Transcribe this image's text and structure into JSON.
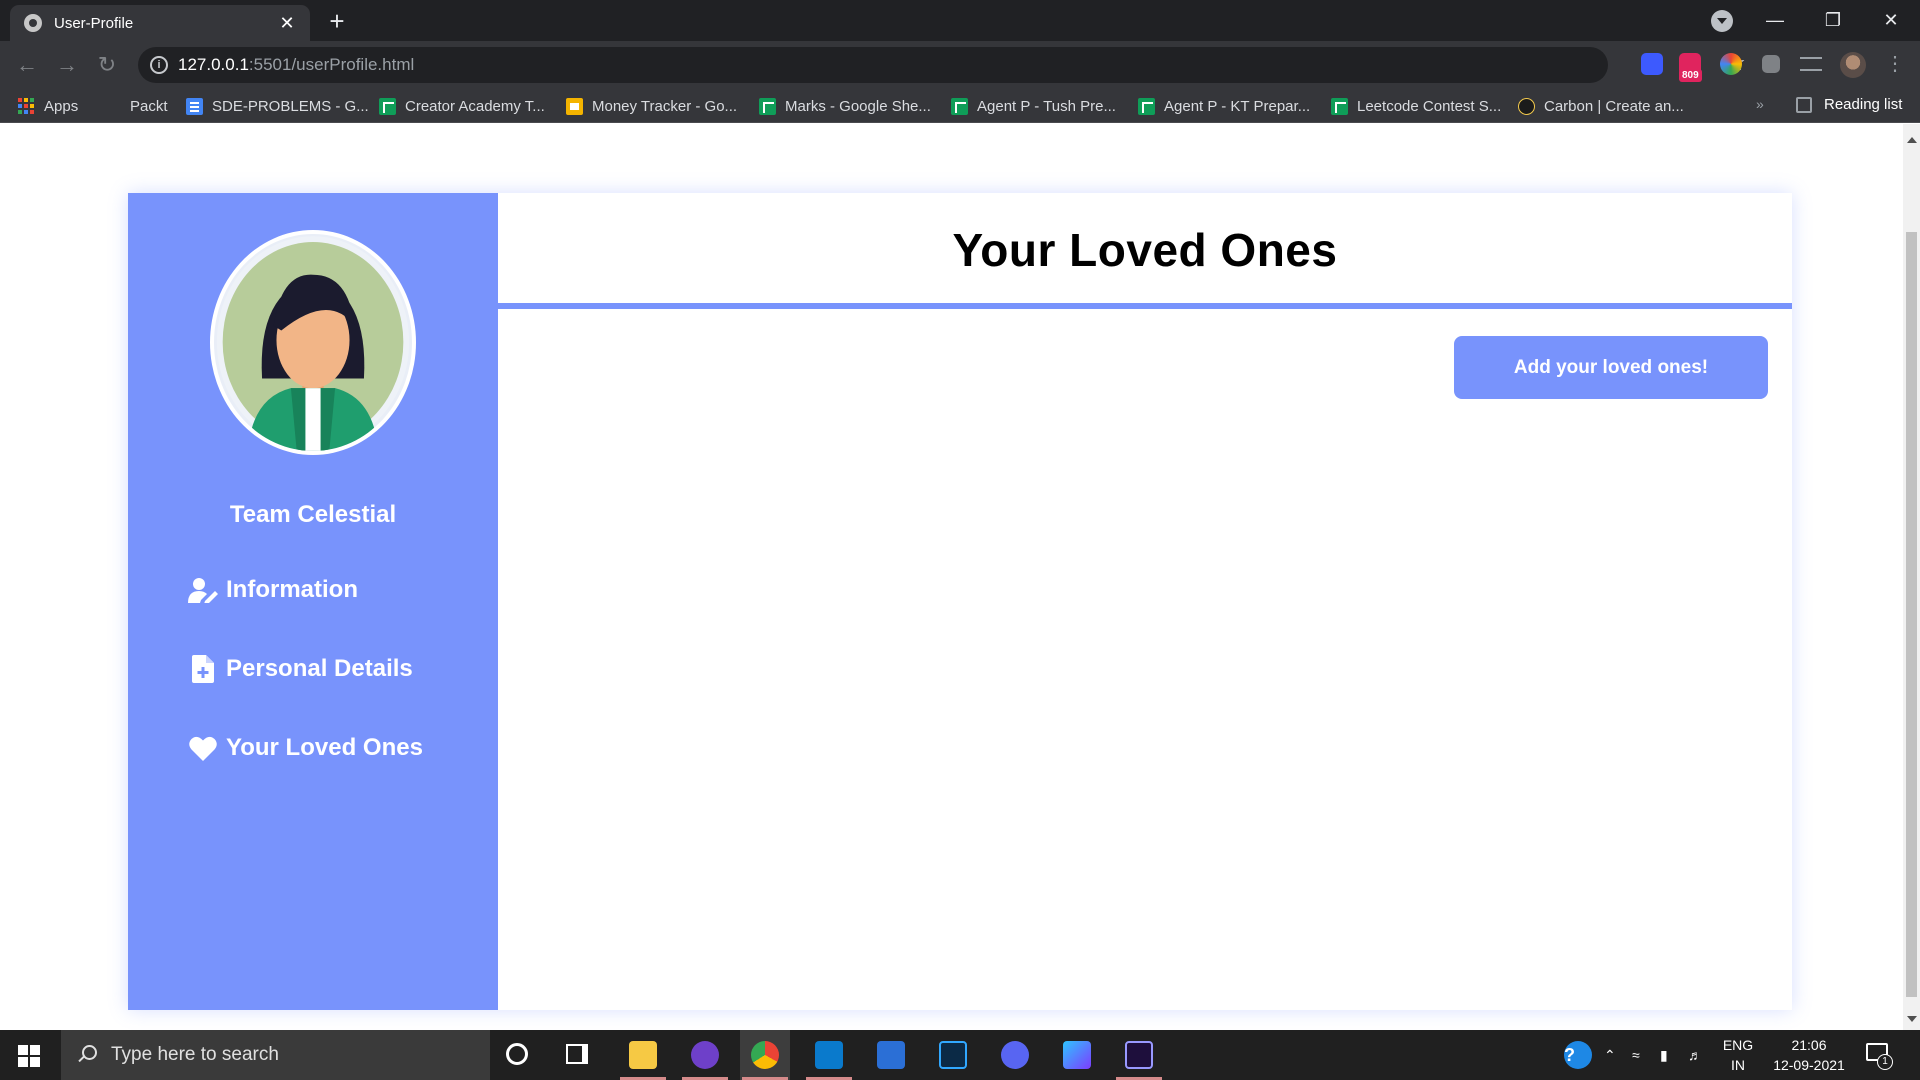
{
  "browser": {
    "tab_title": "User-Profile",
    "tab_close": "✕",
    "new_tab": "+",
    "url_host": "127.0.0.1",
    "url_rest": ":5501/userProfile.html",
    "extension_badge": "809",
    "bookmarks": [
      {
        "label": "Apps",
        "icon": "apps-icon"
      },
      {
        "label": "Packt",
        "icon": "none"
      },
      {
        "label": "SDE-PROBLEMS - G...",
        "icon": "docs-icon"
      },
      {
        "label": "Creator Academy T...",
        "icon": "sheets-icon"
      },
      {
        "label": "Money Tracker - Go...",
        "icon": "slides-icon"
      },
      {
        "label": "Marks - Google She...",
        "icon": "sheets-icon"
      },
      {
        "label": "Agent P - Tush Pre...",
        "icon": "sheets-icon"
      },
      {
        "label": "Agent P - KT Prepar...",
        "icon": "sheets-icon"
      },
      {
        "label": "Leetcode Contest S...",
        "icon": "sheets-icon"
      },
      {
        "label": "Carbon | Create an...",
        "icon": "carbon-icon"
      }
    ],
    "bookmarks_overflow": "»",
    "reading_list": "Reading list"
  },
  "sidebar": {
    "team_name": "Team Celestial",
    "items": [
      {
        "label": "Information",
        "icon": "user-edit-icon"
      },
      {
        "label": "Personal Details",
        "icon": "file-plus-icon"
      },
      {
        "label": "Your Loved Ones",
        "icon": "heart-icon"
      }
    ]
  },
  "main": {
    "title": "Your Loved Ones",
    "add_button": "Add your loved ones!"
  },
  "taskbar": {
    "search_placeholder": "Type here to search",
    "language_line1": "ENG",
    "language_line2": "IN",
    "time": "21:06",
    "date": "12-09-2021",
    "notification_count": "1"
  },
  "colors": {
    "accent": "#7893fc",
    "browser_dark": "#202124",
    "browser_toolbar": "#35363a",
    "taskbar": "#202020"
  }
}
